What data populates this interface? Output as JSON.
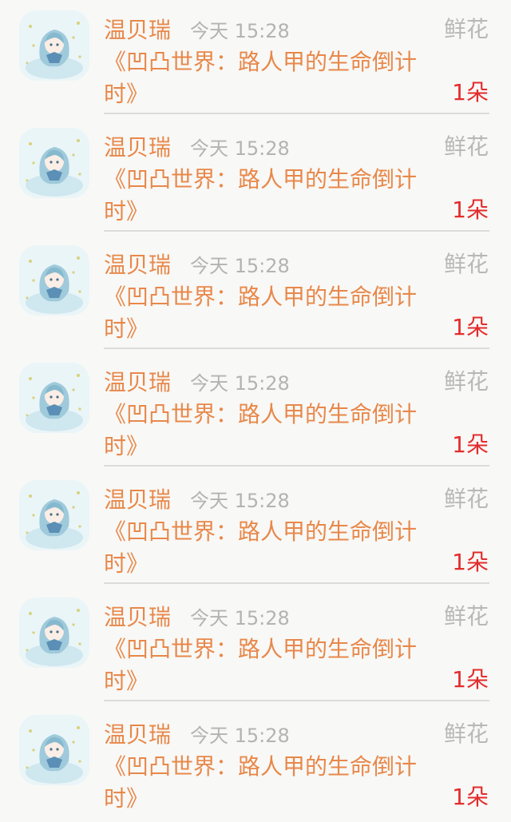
{
  "colors": {
    "accent": "#e8884a",
    "muted": "#b3b3b3",
    "count": "#e22c2c",
    "divider": "#dcdcdc",
    "background": "#f8f8f6"
  },
  "avatar_icon": "anime-girl-avatar",
  "items": [
    {
      "name": "温贝瑞",
      "time": "今天 15:28",
      "type": "鲜花",
      "title": "《凹凸世界：路人甲的生命倒计时》",
      "count": "1朵"
    },
    {
      "name": "温贝瑞",
      "time": "今天 15:28",
      "type": "鲜花",
      "title": "《凹凸世界：路人甲的生命倒计时》",
      "count": "1朵"
    },
    {
      "name": "温贝瑞",
      "time": "今天 15:28",
      "type": "鲜花",
      "title": "《凹凸世界：路人甲的生命倒计时》",
      "count": "1朵"
    },
    {
      "name": "温贝瑞",
      "time": "今天 15:28",
      "type": "鲜花",
      "title": "《凹凸世界：路人甲的生命倒计时》",
      "count": "1朵"
    },
    {
      "name": "温贝瑞",
      "time": "今天 15:28",
      "type": "鲜花",
      "title": "《凹凸世界：路人甲的生命倒计时》",
      "count": "1朵"
    },
    {
      "name": "温贝瑞",
      "time": "今天 15:28",
      "type": "鲜花",
      "title": "《凹凸世界：路人甲的生命倒计时》",
      "count": "1朵"
    },
    {
      "name": "温贝瑞",
      "time": "今天 15:28",
      "type": "鲜花",
      "title": "《凹凸世界：路人甲的生命倒计时》",
      "count": "1朵"
    }
  ]
}
